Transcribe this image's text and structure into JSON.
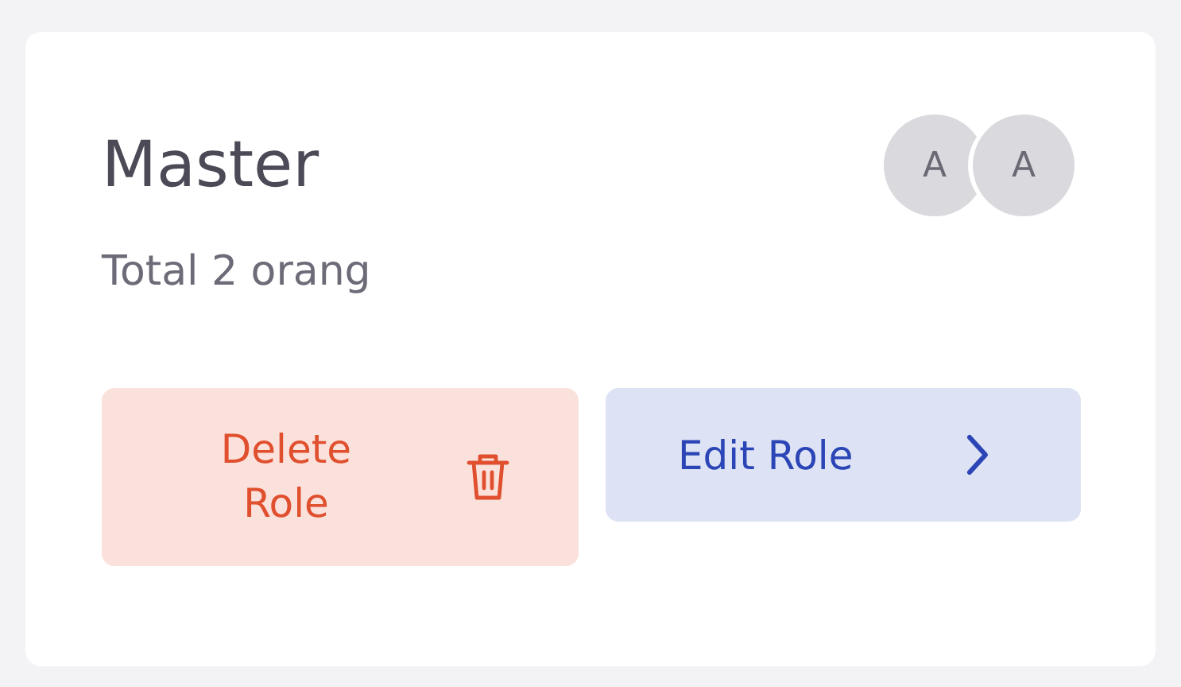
{
  "card": {
    "title": "Master",
    "avatars": [
      "A",
      "A"
    ],
    "subtitle": "Total 2 orang",
    "buttons": [
      {
        "kind": "delete",
        "label": "Delete Role"
      },
      {
        "kind": "edit",
        "label": "Edit Role"
      }
    ]
  }
}
